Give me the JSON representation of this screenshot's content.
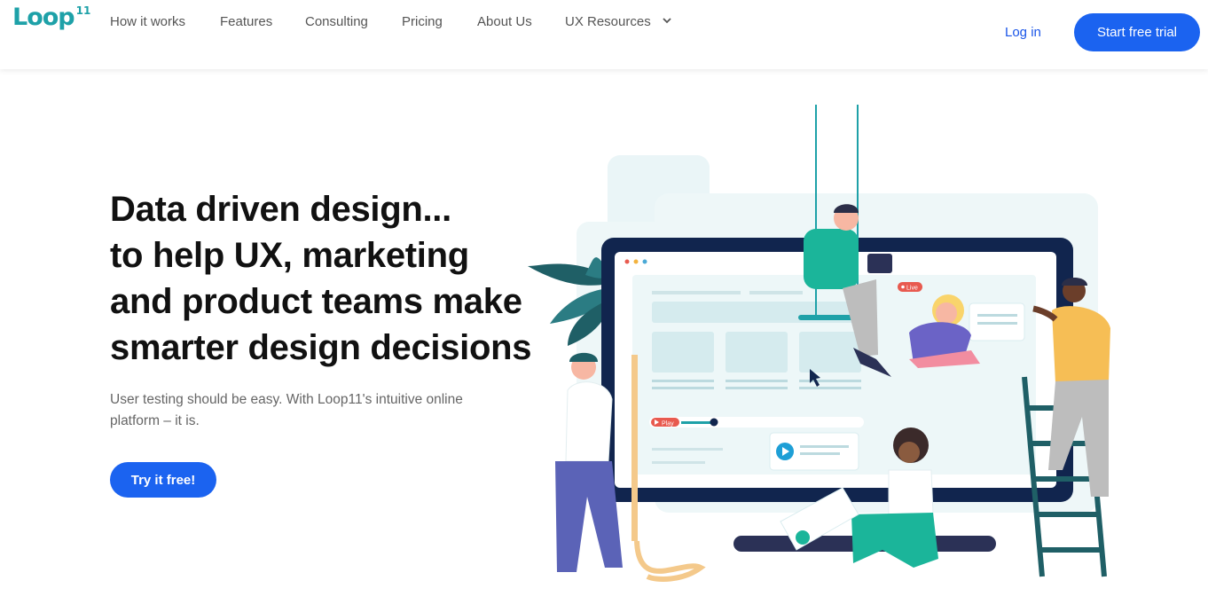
{
  "brand": {
    "logo_text": "Loop",
    "logo_number": "11",
    "accent": "#1ea1a8",
    "primary": "#1b63f0"
  },
  "nav": {
    "items": [
      {
        "label": "How it works"
      },
      {
        "label": "Features"
      },
      {
        "label": "Consulting"
      },
      {
        "label": "Pricing"
      },
      {
        "label": "About Us"
      },
      {
        "label": "UX Resources",
        "has_dropdown": true
      }
    ],
    "login": "Log in",
    "trial": "Start free trial"
  },
  "hero": {
    "headline": [
      "Data driven design...",
      "to help UX, marketing",
      "and product teams make",
      "smarter design decisions"
    ],
    "subtext": "User testing should be easy. With Loop11's intuitive online platform – it is.",
    "cta": "Try it free!"
  },
  "illustration": {
    "live_badge": "Live",
    "play_badge": "Play"
  }
}
